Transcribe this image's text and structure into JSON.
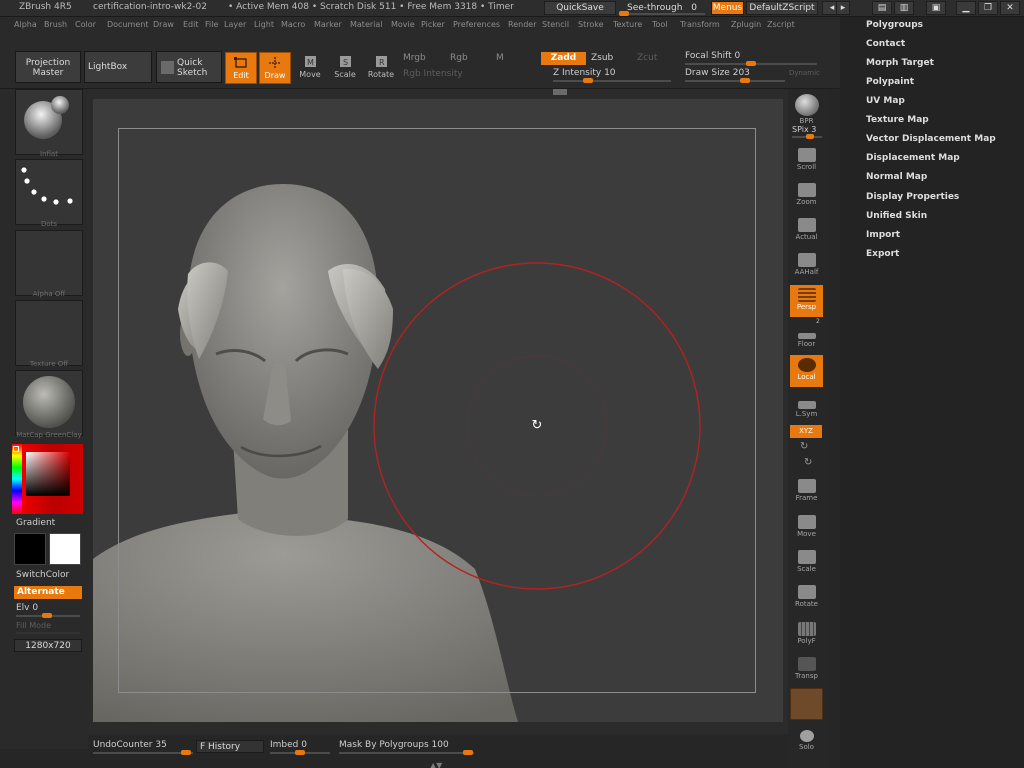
{
  "titlebar": {
    "app": "ZBrush 4R5",
    "document": "certification-intro-wk2-02",
    "status": "• Active Mem 408 • Scratch Disk 511 • Free Mem 3318 • Timer",
    "quicksave": "QuickSave",
    "seethrough": "See-through",
    "seethrough_value": "0",
    "menus": "Menus",
    "script": "DefaultZScript"
  },
  "menubar": [
    "Alpha",
    "Brush",
    "Color",
    "Document",
    "Draw",
    "Edit",
    "File",
    "Layer",
    "Light",
    "Macro",
    "Marker",
    "Material",
    "Movie",
    "Picker",
    "Preferences",
    "Render",
    "Stencil",
    "Stroke",
    "Texture",
    "Tool",
    "Transform",
    "Zplugin",
    "Zscript"
  ],
  "toolbar": {
    "projection_master": "Projection Master",
    "lightbox": "LightBox",
    "quick_sketch": "Quick Sketch",
    "edit": "Edit",
    "draw": "Draw",
    "move": "Move",
    "scale": "Scale",
    "rotate": "Rotate",
    "mrgb": "Mrgb",
    "rgb": "Rgb",
    "m": "M",
    "rgb_intensity": "Rgb Intensity",
    "zadd": "Zadd",
    "zsub": "Zsub",
    "zcut": "Zcut",
    "z_intensity_label": "Z Intensity",
    "z_intensity_value": "10",
    "focal_shift_label": "Focal Shift",
    "focal_shift_value": "0",
    "draw_size_label": "Draw Size",
    "draw_size_value": "203",
    "dynamic": "Dynamic"
  },
  "left": {
    "brush_label": "Inflat",
    "stroke_label": "Dots",
    "alpha_label": "Alpha Off",
    "texture_label": "Texture Off",
    "material_label": "MatCap GreenClay",
    "gradient": "Gradient",
    "switchcolor": "SwitchColor",
    "alternate": "Alternate",
    "elv_label": "Elv",
    "elv_value": "0",
    "fill_mode": "Fill Mode",
    "resolution": "1280x720"
  },
  "shelf": [
    {
      "name": "bpr",
      "label": "BPR",
      "state": "normal"
    },
    {
      "name": "spix",
      "label": "SPix",
      "value": "3"
    },
    {
      "name": "scroll",
      "label": "Scroll"
    },
    {
      "name": "zoom",
      "label": "Zoom"
    },
    {
      "name": "actual",
      "label": "Actual"
    },
    {
      "name": "aahalf",
      "label": "AAHalf"
    },
    {
      "name": "persp",
      "label": "Persp",
      "state": "active"
    },
    {
      "name": "floor",
      "label": "Floor"
    },
    {
      "name": "local",
      "label": "Local",
      "state": "active"
    },
    {
      "name": "lsym",
      "label": "L.Sym"
    },
    {
      "name": "xyz",
      "label": "XYZ",
      "state": "active"
    },
    {
      "name": "frame",
      "label": "Frame"
    },
    {
      "name": "move",
      "label": "Move"
    },
    {
      "name": "scale",
      "label": "Scale"
    },
    {
      "name": "rotate",
      "label": "Rotate"
    },
    {
      "name": "polyf",
      "label": "PolyF"
    },
    {
      "name": "transp",
      "label": "Transp"
    },
    {
      "name": "solo",
      "label": "Solo"
    }
  ],
  "shelf_badge": "2",
  "sidebar": [
    "Polygroups",
    "Contact",
    "Morph Target",
    "Polypaint",
    "UV Map",
    "Texture Map",
    "Vector Displacement Map",
    "Displacement Map",
    "Normal Map",
    "Display Properties",
    "Unified Skin",
    "Import",
    "Export"
  ],
  "bottom": {
    "undo_label": "UndoCounter",
    "undo_value": "35",
    "history": "F History",
    "imbed_label": "Imbed",
    "imbed_value": "0",
    "mask_label": "Mask By Polygroups",
    "mask_value": "100"
  },
  "colors": {
    "accent": "#e8790f",
    "brush_cursor": "#b32222",
    "background": "#262626",
    "viewport": "#3c3c3c"
  }
}
